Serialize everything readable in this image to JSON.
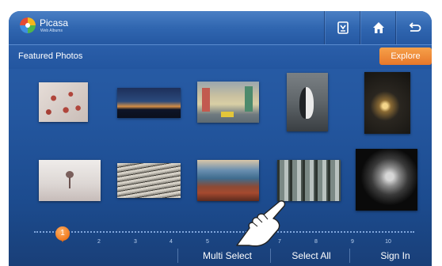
{
  "app": {
    "name": "Picasa",
    "subname": "Web Albums"
  },
  "toolbar": {
    "buttons": [
      {
        "icon": "mirror-phone-icon"
      },
      {
        "icon": "home-icon"
      },
      {
        "icon": "back-icon"
      }
    ]
  },
  "header": {
    "title": "Featured Photos",
    "explore_label": "Explore"
  },
  "photos": [
    {
      "name": "photo-red-flowers",
      "colors": [
        "#c9bdb7",
        "#b0453b",
        "#e6ddd8"
      ]
    },
    {
      "name": "photo-city-night-skyline",
      "colors": [
        "#1c2e55",
        "#e8a34a",
        "#0e1527"
      ]
    },
    {
      "name": "photo-street-scene",
      "colors": [
        "#8f9aa3",
        "#d9cfa5",
        "#5d6a72"
      ]
    },
    {
      "name": "photo-penguin",
      "colors": [
        "#6d7377",
        "#eaeaea",
        "#2c2f33"
      ]
    },
    {
      "name": "photo-lamp-glow",
      "colors": [
        "#1c1a17",
        "#f4d58a",
        "#3a342b"
      ]
    },
    {
      "name": "photo-lone-tree",
      "colors": [
        "#e9e6e4",
        "#b9aaa7",
        "#7a5f5c"
      ]
    },
    {
      "name": "photo-birds-on-wires",
      "colors": [
        "#a9a59c",
        "#3d3a34",
        "#d5d0c6"
      ]
    },
    {
      "name": "photo-rocky-coast",
      "colors": [
        "#3f6c8e",
        "#a54a2f",
        "#d9c6a8"
      ]
    },
    {
      "name": "photo-foggy-forest",
      "colors": [
        "#b9c2bf",
        "#2d342f",
        "#7b8985"
      ]
    },
    {
      "name": "photo-cat-portrait",
      "colors": [
        "#0a0a0a",
        "#d6d6d6",
        "#5a5a5a"
      ]
    }
  ],
  "pager": {
    "current": "1",
    "ticks": [
      "2",
      "3",
      "4",
      "5",
      "6",
      "7",
      "8",
      "9",
      "10"
    ]
  },
  "bottom": {
    "multi_select": "Multi Select",
    "select_all": "Select All",
    "sign_in": "Sign In"
  },
  "colors": {
    "accent": "#e7772a",
    "background": "#2457a0"
  }
}
